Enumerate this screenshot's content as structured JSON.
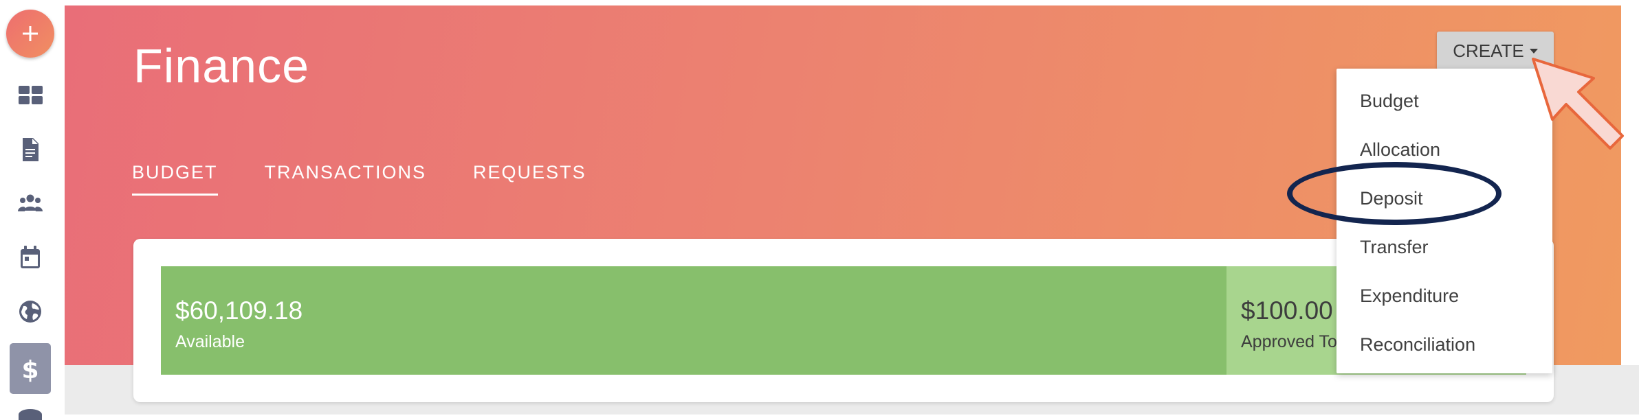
{
  "sidebar": {
    "fab_icon": "plus-icon",
    "items": [
      {
        "name": "dashboard-icon"
      },
      {
        "name": "document-icon"
      },
      {
        "name": "people-icon"
      },
      {
        "name": "calendar-icon"
      },
      {
        "name": "globe-icon"
      },
      {
        "name": "dollar-icon",
        "active": true
      }
    ]
  },
  "header": {
    "title": "Finance",
    "tabs": [
      {
        "label": "BUDGET",
        "active": true
      },
      {
        "label": "TRANSACTIONS"
      },
      {
        "label": "REQUESTS"
      }
    ],
    "create_label": "CREATE"
  },
  "create_menu": {
    "items": [
      "Budget",
      "Allocation",
      "Deposit",
      "Transfer",
      "Expenditure",
      "Reconciliation"
    ]
  },
  "budget": {
    "available": {
      "amount": "$60,109.18",
      "label": "Available"
    },
    "approved": {
      "amount": "$100.00",
      "label": "Approved To"
    }
  },
  "colors": {
    "header_start": "#e96e78",
    "header_end": "#f09a60",
    "available_bar": "#87bf6c",
    "approved_bar": "#a8d58e",
    "sidebar_active": "#8f93a8",
    "annotation_ellipse": "#13254f",
    "annotation_arrow": "#f9d9d3"
  }
}
